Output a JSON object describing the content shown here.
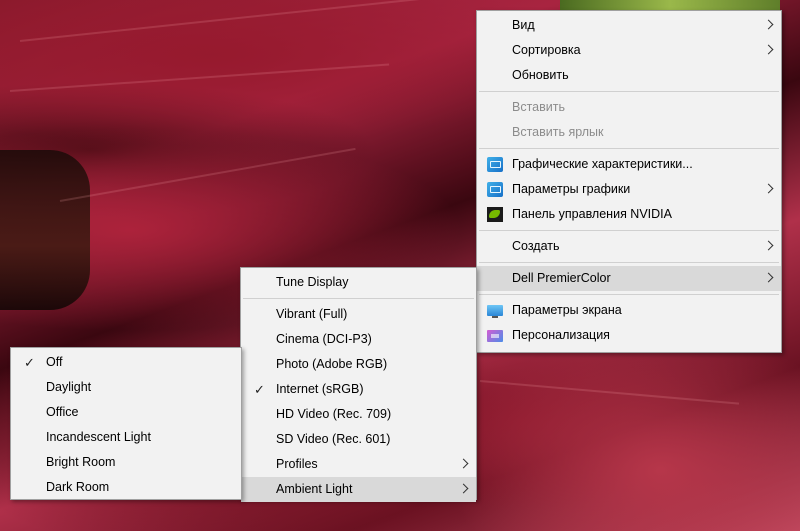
{
  "desktop_menu": {
    "items": [
      {
        "label": "Вид"
      },
      {
        "label": "Сортировка"
      },
      {
        "label": "Обновить"
      },
      {
        "label": "Вставить"
      },
      {
        "label": "Вставить ярлык"
      },
      {
        "label": "Графические характеристики..."
      },
      {
        "label": "Параметры графики"
      },
      {
        "label": "Панель управления NVIDIA"
      },
      {
        "label": "Создать"
      },
      {
        "label": "Dell PremierColor"
      },
      {
        "label": "Параметры экрана"
      },
      {
        "label": "Персонализация"
      }
    ]
  },
  "premiercolor_menu": {
    "items": [
      {
        "label": "Tune Display"
      },
      {
        "label": "Vibrant (Full)"
      },
      {
        "label": "Cinema (DCI-P3)"
      },
      {
        "label": "Photo (Adobe RGB)"
      },
      {
        "label": "Internet (sRGB)"
      },
      {
        "label": "HD Video (Rec. 709)"
      },
      {
        "label": "SD Video (Rec. 601)"
      },
      {
        "label": "Profiles"
      },
      {
        "label": "Ambient Light"
      }
    ]
  },
  "ambient_menu": {
    "items": [
      {
        "label": "Off"
      },
      {
        "label": "Daylight"
      },
      {
        "label": "Office"
      },
      {
        "label": "Incandescent Light"
      },
      {
        "label": "Bright Room"
      },
      {
        "label": "Dark Room"
      }
    ]
  },
  "icons": {
    "check": "✓",
    "graphics_props": "intel-graphics-icon",
    "graphics_settings": "intel-graphics-icon",
    "nvidia": "nvidia-icon",
    "display": "display-icon",
    "personalization": "personalization-icon"
  },
  "colors": {
    "menu_bg": "#f2f2f2",
    "highlight": "#d9d9d9",
    "disabled_text": "#8c8c8c"
  }
}
